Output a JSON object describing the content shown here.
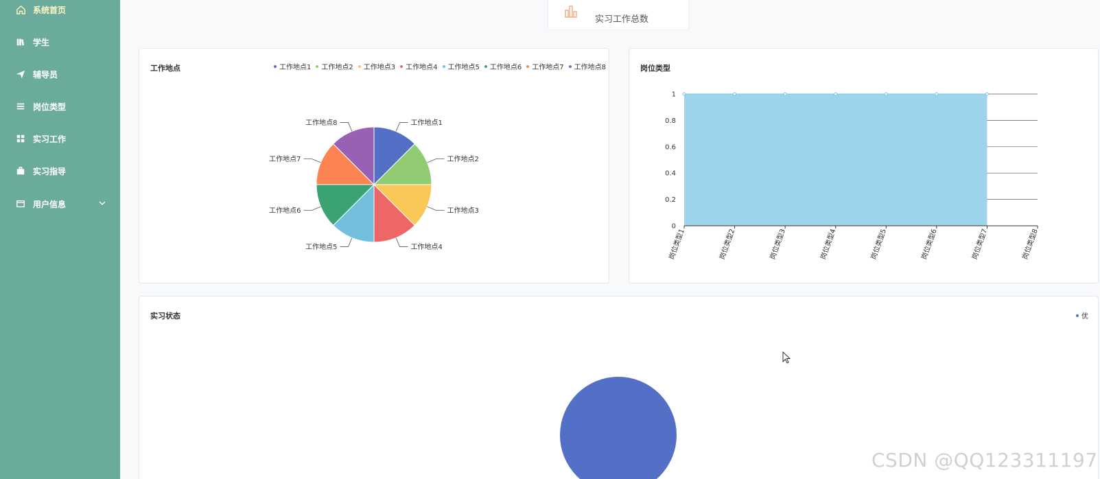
{
  "sidebar": {
    "items": [
      {
        "label": "系统首页",
        "icon": "home-icon"
      },
      {
        "label": "学生",
        "icon": "bookshelf-icon"
      },
      {
        "label": "辅导员",
        "icon": "paper-plane-icon"
      },
      {
        "label": "岗位类型",
        "icon": "list-icon"
      },
      {
        "label": "实习工作",
        "icon": "grid-icon"
      },
      {
        "label": "实习指导",
        "icon": "briefcase-icon"
      },
      {
        "label": "用户信息",
        "icon": "window-icon"
      }
    ],
    "colors": {
      "background": "#6aab9c",
      "active_text": "#fff7c2"
    }
  },
  "stat_card": {
    "label": "实习工作总数",
    "icon": "bar-chart-icon"
  },
  "panels": {
    "location": {
      "title": "工作地点"
    },
    "job_type": {
      "title": "岗位类型"
    },
    "status": {
      "title": "实习状态"
    }
  },
  "watermark": "CSDN @QQ123311197",
  "chart_data": [
    {
      "type": "pie",
      "title": "工作地点",
      "legend_position": "top-right",
      "categories": [
        "工作地点1",
        "工作地点2",
        "工作地点3",
        "工作地点4",
        "工作地点5",
        "工作地点6",
        "工作地点7",
        "工作地点8"
      ],
      "values": [
        1,
        1,
        1,
        1,
        1,
        1,
        1,
        1
      ],
      "colors": [
        "#5470c6",
        "#91cc75",
        "#fac858",
        "#ee6666",
        "#73c0de",
        "#3ba272",
        "#fc8452",
        "#9a60b4"
      ]
    },
    {
      "type": "area",
      "title": "岗位类型",
      "categories": [
        "岗位类型1",
        "岗位类型2",
        "岗位类型3",
        "岗位类型4",
        "岗位类型5",
        "岗位类型6",
        "岗位类型7",
        "岗位类型8"
      ],
      "values": [
        1,
        1,
        1,
        1,
        1,
        1,
        1
      ],
      "ylim": [
        0,
        1
      ],
      "yticks": [
        "0",
        "0.2",
        "0.4",
        "0.6",
        "0.8",
        "1"
      ],
      "grid": true,
      "color": "#9dd4eb"
    },
    {
      "type": "pie",
      "title": "实习状态",
      "legend_position": "top-right",
      "categories": [
        "优"
      ],
      "values": [
        1
      ],
      "colors": [
        "#5470c6"
      ]
    }
  ]
}
